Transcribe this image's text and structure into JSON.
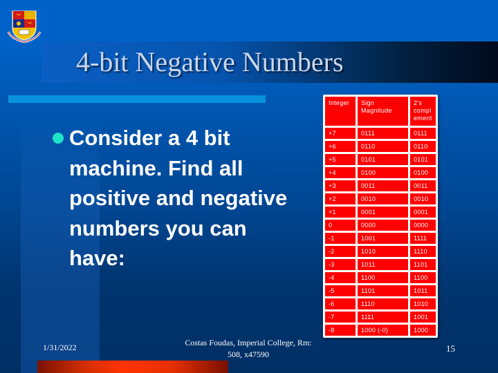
{
  "slide": {
    "title": "4-bit Negative Numbers",
    "bullet": "Consider a 4 bit machine. Find all positive and negative numbers you can have:",
    "logo_icon": "imperial-college-crest",
    "colors": {
      "background": "#0062c8",
      "rule": "#0892de",
      "bullet": "#1de3c8",
      "table_cell": "#ff0000",
      "accent_bar": "#ff3300"
    }
  },
  "table": {
    "headers": [
      "Integer",
      "Sign Magnitude",
      "2's compl ement"
    ],
    "rows": [
      [
        "+7",
        "0111",
        "0111"
      ],
      [
        "+6",
        "0110",
        "0110"
      ],
      [
        "+5",
        "0101",
        "0101"
      ],
      [
        "+4",
        "0100",
        "0100"
      ],
      [
        "+3",
        "0011",
        "0011"
      ],
      [
        "+2",
        "0010",
        "0010"
      ],
      [
        "+1",
        "0001",
        "0001"
      ],
      [
        "0",
        "0000",
        "0000"
      ],
      [
        "-1",
        "1001",
        "1111"
      ],
      [
        "-2",
        "1010",
        "1110"
      ],
      [
        "-3",
        "1011",
        "1101"
      ],
      [
        "-4",
        "1100",
        "1100"
      ],
      [
        "-5",
        "1101",
        "1011"
      ],
      [
        "-6",
        "1110",
        "1010"
      ],
      [
        "-7",
        "1111",
        "1001"
      ],
      [
        "-8",
        "1000 (-0)",
        "1000"
      ]
    ]
  },
  "footer": {
    "date": "1/31/2022",
    "author_line1": "Costas Foudas, Imperial College, Rm:",
    "author_line2": "508, x47590",
    "page": "15"
  }
}
